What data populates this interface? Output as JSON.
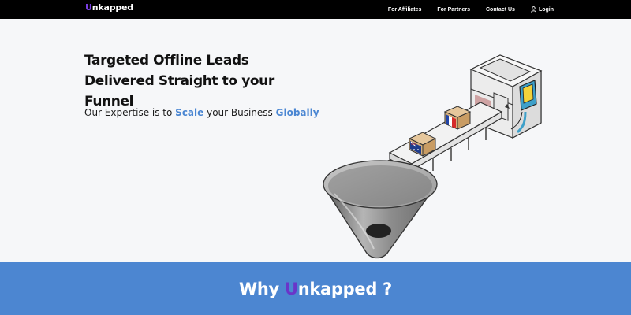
{
  "brand": {
    "logo_letter": "U",
    "logo_rest": "nkapped"
  },
  "nav": {
    "affiliates": "For Affiliates",
    "partners": "For Partners",
    "contact": "Contact Us",
    "login": "Login",
    "login_icon": "user-icon"
  },
  "hero": {
    "headline_line1": "Targeted Offline Leads",
    "headline_line2": "Delivered Straight to your Funnel",
    "tagline_prefix": "Our Expertise is to ",
    "tagline_scale": "Scale",
    "tagline_middle": " your Business ",
    "tagline_globally": "Globally",
    "illustration": "conveyor-machine-funnel-illustration",
    "flags": [
      "spain-flag",
      "australia-flag",
      "france-flag"
    ]
  },
  "why": {
    "prefix": "Why ",
    "brand_letter": "U",
    "brand_rest": "nkapped",
    "suffix": " ?"
  },
  "colors": {
    "nav_bg": "#000000",
    "accent_blue": "#4a86d2",
    "band_blue": "#4c86d1",
    "brand_purple": "#7b3fe4",
    "page_bg": "#f6f7f9"
  }
}
